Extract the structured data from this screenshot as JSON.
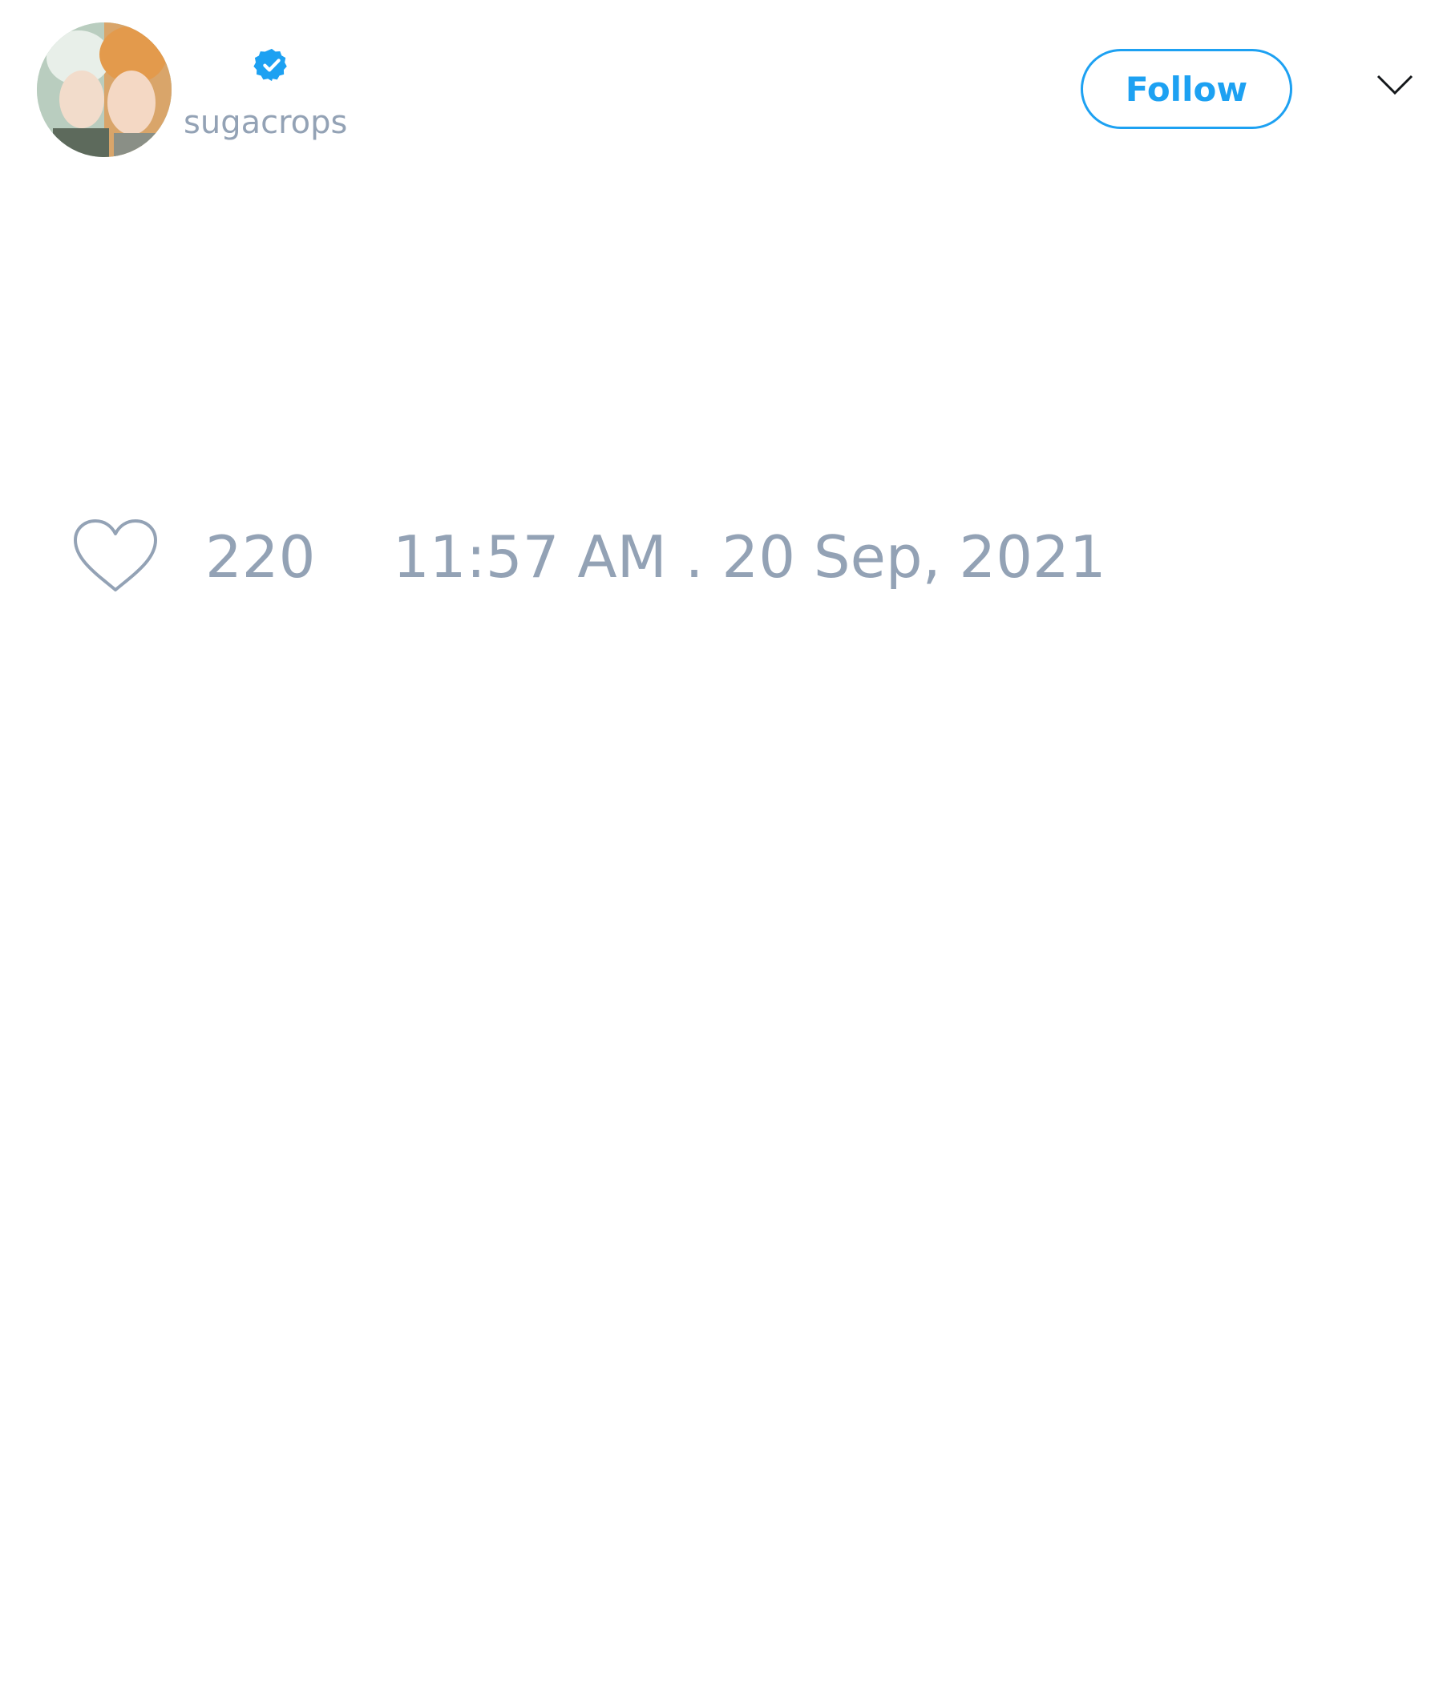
{
  "header": {
    "handle": "sugacrops",
    "avatar_icon": "profile-photo",
    "verified_icon": "verified-badge-icon",
    "follow_label": "Follow",
    "menu_icon": "chevron-down-icon"
  },
  "engagement": {
    "like_icon": "heart-icon",
    "like_count": "220",
    "timestamp": "11:57 AM . 20 Sep, 2021"
  },
  "colors": {
    "accent": "#1da1f2",
    "muted_text": "#93a2b5",
    "background": "#ffffff"
  }
}
